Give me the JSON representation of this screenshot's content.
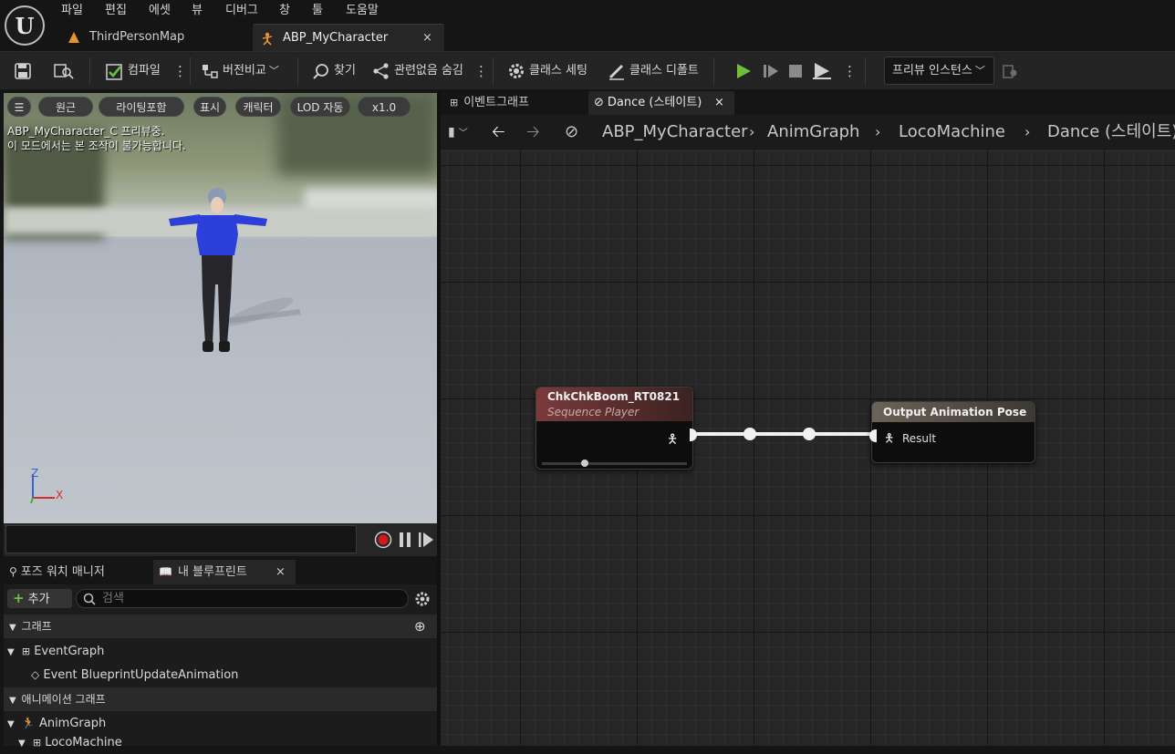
{
  "menu": [
    "파일",
    "편집",
    "에셋",
    "뷰",
    "디버그",
    "창",
    "툴",
    "도움말"
  ],
  "doc_tabs": [
    {
      "label": "ThirdPersonMap",
      "active": false
    },
    {
      "label": "ABP_MyCharacter",
      "active": true
    }
  ],
  "toolbar": {
    "compile_label": "컴파일",
    "diff_label": "버전비교",
    "find_label": "찾기",
    "hide_unrelated_label": "관련없음 숨김",
    "class_settings_label": "클래스 세팅",
    "class_defaults_label": "클래스 디폴트",
    "preview_instance_label": "프리뷰 인스턴스"
  },
  "viewport": {
    "pills": [
      "원근",
      "라이팅포함",
      "표시",
      "캐릭터",
      "LOD 자동",
      "x1.0"
    ],
    "info_line1": "ABP_MyCharacter_C 프리뷰중.",
    "info_line2": "이 모드에서는 본 조작이 불가능합니다.",
    "axis_z": "Z",
    "axis_x": "X",
    "character_shirt_color": "#2c3fd8"
  },
  "left_panel": {
    "tabs": [
      "포즈 워치 매니저",
      "내 블루프린트"
    ],
    "add_label": "추가",
    "search_placeholder": "검색",
    "sections": {
      "graphs": "그래프",
      "anim_graphs": "애니메이션 그래프"
    },
    "tree": {
      "event_graph": "EventGraph",
      "event_update": "Event BlueprintUpdateAnimation",
      "anim_graph": "AnimGraph",
      "loco_machine": "LocoMachine"
    }
  },
  "graph": {
    "tabs": [
      {
        "label": "이벤트그래프",
        "active": false
      },
      {
        "label": "Dance (스테이트)",
        "active": true
      }
    ],
    "breadcrumb": [
      "ABP_MyCharacter",
      "AnimGraph",
      "LocoMachine",
      "Dance (스테이트)"
    ],
    "nodes": {
      "sequence_player": {
        "title": "ChkChkBoom_RT0821",
        "subtitle": "Sequence Player",
        "header_color": "#7a3a3a"
      },
      "output_pose": {
        "title": "Output Animation Pose",
        "pin_label": "Result",
        "header_color": "#6b6357"
      }
    }
  }
}
